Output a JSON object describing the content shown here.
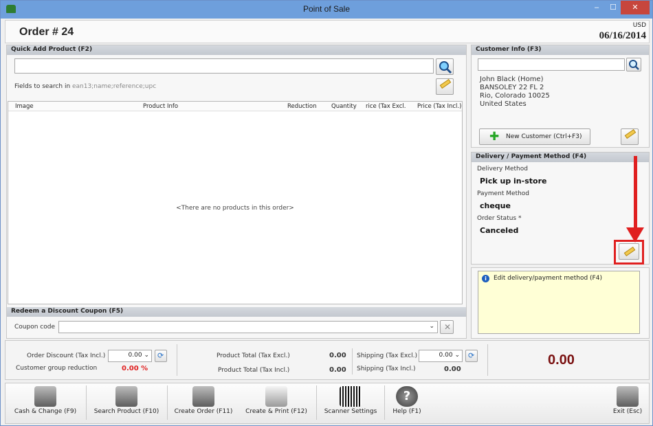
{
  "window": {
    "title": "Point of Sale",
    "min": "–",
    "max": "☐",
    "close": "✕"
  },
  "header": {
    "order": "Order # 24",
    "currency": "USD",
    "date": "06/16/2014"
  },
  "quick_add": {
    "title": "Quick Add Product (F2)",
    "fields_label": "Fields to search in",
    "fields_value": "ean13;name;reference;upc"
  },
  "grid": {
    "columns": [
      "Image",
      "Product Info",
      "Reduction",
      "Quantity",
      "rice (Tax Excl.",
      "Price (Tax Incl.)"
    ],
    "empty": "<There are no products in this order>"
  },
  "coupon": {
    "title": "Redeem a Discount Coupon (F5)",
    "label": "Coupon code"
  },
  "customer": {
    "title": "Customer Info (F3)",
    "lines": [
      "John Black (Home)",
      "BANSOLEY 22 FL 2",
      "Rio, Colorado 10025",
      "United States"
    ],
    "new_button": "New Customer (Ctrl+F3)"
  },
  "delivery": {
    "title": "Delivery / Payment Method (F4)",
    "delivery_label": "Delivery Method",
    "delivery_value": "Pick up in-store",
    "payment_label": "Payment Method",
    "payment_value": "cheque",
    "status_label": "Order Status *",
    "status_value": "Canceled"
  },
  "hint": {
    "text": "Edit delivery/payment method (F4)",
    "icon": "info-icon"
  },
  "totals": {
    "order_discount_label": "Order Discount (Tax Incl.)",
    "order_discount_value": "0.00",
    "group_reduction_label": "Customer group reduction",
    "group_reduction_value": "0.00 %",
    "product_total_excl_label": "Product Total (Tax Excl.)",
    "product_total_excl_value": "0.00",
    "product_total_incl_label": "Product Total (Tax Incl.)",
    "product_total_incl_value": "0.00",
    "shipping_excl_label": "Shipping (Tax Excl.)",
    "shipping_excl_value": "0.00",
    "shipping_incl_label": "Shipping (Tax Incl.)",
    "shipping_incl_value": "0.00",
    "grand_total": "0.00"
  },
  "toolbar": {
    "cash": "Cash & Change (F9)",
    "search": "Search Product (F10)",
    "create": "Create Order (F11)",
    "create_print": "Create & Print (F12)",
    "scanner": "Scanner Settings",
    "help": "Help (F1)",
    "exit": "Exit (Esc)"
  },
  "colors": {
    "accent_red": "#e02020",
    "total_red": "#7a1010",
    "titlebar": "#6e9fdc"
  }
}
